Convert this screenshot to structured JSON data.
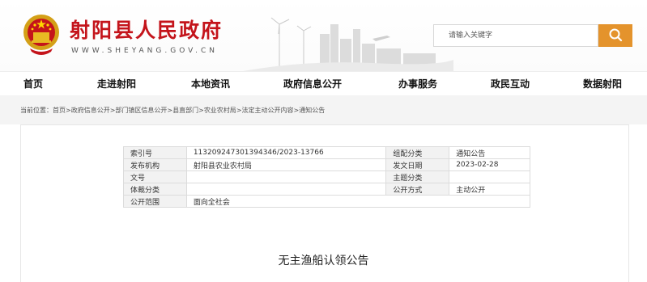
{
  "header": {
    "site_title": "射阳县人民政府",
    "site_url": "WWW.SHEYANG.GOV.CN",
    "emblem_icon": "national-emblem-icon",
    "search": {
      "placeholder": "请输入关键字",
      "button_icon": "search-icon"
    }
  },
  "colors": {
    "brand_red": "#c4141b",
    "search_orange": "#e4932c"
  },
  "nav": {
    "items": [
      {
        "label": "首页"
      },
      {
        "label": "走进射阳"
      },
      {
        "label": "本地资讯"
      },
      {
        "label": "政府信息公开"
      },
      {
        "label": "办事服务"
      },
      {
        "label": "政民互动"
      },
      {
        "label": "数据射阳"
      }
    ]
  },
  "breadcrumb": {
    "prefix": "当前位置：",
    "items": [
      {
        "label": "首页"
      },
      {
        "label": "政府信息公开"
      },
      {
        "label": "部门镇区信息公开"
      },
      {
        "label": "县直部门"
      },
      {
        "label": "农业农村局"
      },
      {
        "label": "法定主动公开内容"
      },
      {
        "label": "通知公告"
      }
    ],
    "separator": ">"
  },
  "info_table": {
    "rows": [
      {
        "l1": "索引号",
        "v1": "113209247301394346/2023-13766",
        "l2": "组配分类",
        "v2": "通知公告"
      },
      {
        "l1": "发布机构",
        "v1": "射阳县农业农村局",
        "l2": "发文日期",
        "v2": "2023-02-28"
      },
      {
        "l1": "文号",
        "v1": "",
        "l2": "主题分类",
        "v2": ""
      },
      {
        "l1": "体裁分类",
        "v1": "",
        "l2": "公开方式",
        "v2": "主动公开"
      },
      {
        "l1": "公开范围",
        "v1": "面向全社会"
      }
    ]
  },
  "document": {
    "title": "无主渔船认领公告"
  }
}
